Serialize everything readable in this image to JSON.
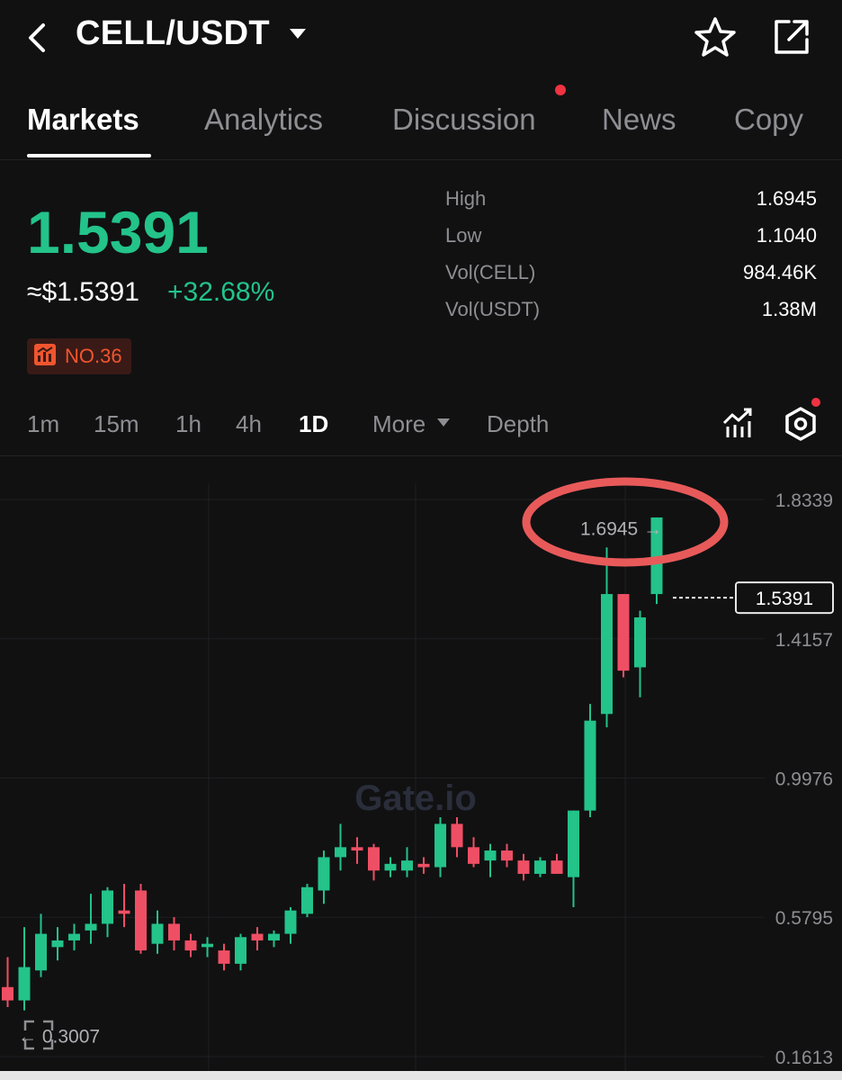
{
  "header": {
    "pair": "CELL/USDT",
    "icons": {
      "back": "back-arrow-icon",
      "dropdown": "caret-down-icon",
      "favorite": "star-icon",
      "share": "share-icon"
    }
  },
  "tabs": [
    {
      "label": "Markets",
      "active": true
    },
    {
      "label": "Analytics",
      "active": false
    },
    {
      "label": "Discussion",
      "active": false,
      "has_notification": true
    },
    {
      "label": "News",
      "active": false
    },
    {
      "label": "Copy",
      "active": false
    }
  ],
  "ticker": {
    "last_price": "1.5391",
    "usd_price": "≈$1.5391",
    "change": "+32.68%",
    "rank": "NO.36",
    "colors": {
      "up": "#23c38a",
      "down": "#ef4f64",
      "rank": "#f0552f"
    }
  },
  "stats": [
    {
      "label": "High",
      "value": "1.6945"
    },
    {
      "label": "Low",
      "value": "1.1040"
    },
    {
      "label": "Vol(CELL)",
      "value": "984.46K"
    },
    {
      "label": "Vol(USDT)",
      "value": "1.38M"
    }
  ],
  "timeframes": {
    "items": [
      "1m",
      "15m",
      "1h",
      "4h",
      "1D"
    ],
    "active": "1D",
    "more": "More",
    "depth": "Depth",
    "icons": {
      "indicators": "indicator-chart-icon",
      "settings": "settings-hex-icon"
    }
  },
  "chart_data": {
    "type": "candlestick",
    "y_axis_labels": [
      "1.8339",
      "1.4157",
      "0.9976",
      "0.5795",
      "0.1613"
    ],
    "ylim": [
      0.1613,
      1.8339
    ],
    "current_price_label": "1.5391",
    "high_marker": "1.6945 →",
    "low_marker": "← 0.3007",
    "watermark": "Gate.io",
    "annotation": "red-circle-around-high",
    "candles": [
      {
        "o": 0.37,
        "h": 0.46,
        "l": 0.31,
        "c": 0.33
      },
      {
        "o": 0.33,
        "h": 0.55,
        "l": 0.3,
        "c": 0.43
      },
      {
        "o": 0.42,
        "h": 0.59,
        "l": 0.4,
        "c": 0.53
      },
      {
        "o": 0.49,
        "h": 0.55,
        "l": 0.45,
        "c": 0.51
      },
      {
        "o": 0.51,
        "h": 0.56,
        "l": 0.48,
        "c": 0.53
      },
      {
        "o": 0.54,
        "h": 0.65,
        "l": 0.5,
        "c": 0.56
      },
      {
        "o": 0.56,
        "h": 0.67,
        "l": 0.52,
        "c": 0.66
      },
      {
        "o": 0.6,
        "h": 0.68,
        "l": 0.55,
        "c": 0.59
      },
      {
        "o": 0.66,
        "h": 0.68,
        "l": 0.47,
        "c": 0.48
      },
      {
        "o": 0.5,
        "h": 0.6,
        "l": 0.47,
        "c": 0.56
      },
      {
        "o": 0.56,
        "h": 0.58,
        "l": 0.48,
        "c": 0.51
      },
      {
        "o": 0.51,
        "h": 0.53,
        "l": 0.46,
        "c": 0.48
      },
      {
        "o": 0.49,
        "h": 0.52,
        "l": 0.46,
        "c": 0.5
      },
      {
        "o": 0.48,
        "h": 0.5,
        "l": 0.42,
        "c": 0.44
      },
      {
        "o": 0.44,
        "h": 0.53,
        "l": 0.42,
        "c": 0.52
      },
      {
        "o": 0.53,
        "h": 0.55,
        "l": 0.48,
        "c": 0.51
      },
      {
        "o": 0.51,
        "h": 0.54,
        "l": 0.49,
        "c": 0.53
      },
      {
        "o": 0.53,
        "h": 0.61,
        "l": 0.5,
        "c": 0.6
      },
      {
        "o": 0.59,
        "h": 0.68,
        "l": 0.58,
        "c": 0.67
      },
      {
        "o": 0.66,
        "h": 0.78,
        "l": 0.62,
        "c": 0.76
      },
      {
        "o": 0.76,
        "h": 0.86,
        "l": 0.72,
        "c": 0.79
      },
      {
        "o": 0.79,
        "h": 0.82,
        "l": 0.74,
        "c": 0.78
      },
      {
        "o": 0.79,
        "h": 0.8,
        "l": 0.69,
        "c": 0.72
      },
      {
        "o": 0.72,
        "h": 0.76,
        "l": 0.7,
        "c": 0.74
      },
      {
        "o": 0.72,
        "h": 0.79,
        "l": 0.7,
        "c": 0.75
      },
      {
        "o": 0.74,
        "h": 0.76,
        "l": 0.71,
        "c": 0.73
      },
      {
        "o": 0.73,
        "h": 0.88,
        "l": 0.7,
        "c": 0.86
      },
      {
        "o": 0.86,
        "h": 0.88,
        "l": 0.76,
        "c": 0.79
      },
      {
        "o": 0.79,
        "h": 0.82,
        "l": 0.73,
        "c": 0.74
      },
      {
        "o": 0.75,
        "h": 0.8,
        "l": 0.7,
        "c": 0.78
      },
      {
        "o": 0.78,
        "h": 0.8,
        "l": 0.73,
        "c": 0.75
      },
      {
        "o": 0.75,
        "h": 0.77,
        "l": 0.69,
        "c": 0.71
      },
      {
        "o": 0.71,
        "h": 0.76,
        "l": 0.7,
        "c": 0.75
      },
      {
        "o": 0.75,
        "h": 0.77,
        "l": 0.71,
        "c": 0.71
      },
      {
        "o": 0.7,
        "h": 0.9,
        "l": 0.61,
        "c": 0.9
      },
      {
        "o": 0.9,
        "h": 1.22,
        "l": 0.88,
        "c": 1.17
      },
      {
        "o": 1.19,
        "h": 1.69,
        "l": 1.15,
        "c": 1.55
      },
      {
        "o": 1.55,
        "h": 1.51,
        "l": 1.3,
        "c": 1.32
      },
      {
        "o": 1.33,
        "h": 1.5,
        "l": 1.24,
        "c": 1.48
      },
      {
        "o": 1.55,
        "h": 1.69,
        "l": 1.52,
        "c": 1.78
      }
    ]
  }
}
